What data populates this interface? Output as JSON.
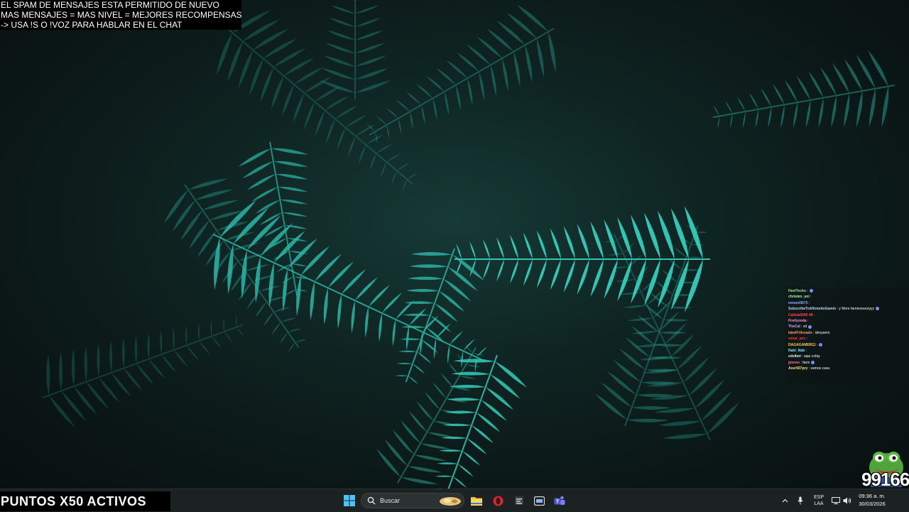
{
  "stream_overlay": {
    "lines": [
      "EL SPAM DE MENSAJES ESTA PERMITIDO DE NUEVO",
      "MAS MENSAJES = MAS NIVEL = MEJORES RECOMPENSAS",
      "-> USA !S  O !VOZ PARA HABLAR EN EL CHAT"
    ],
    "points_banner": "PUNTOS X50 ACTIVOS",
    "counter": "99166"
  },
  "chat": {
    "messages": [
      {
        "user": "HeelTecho",
        "text": ":",
        "color": "#9fe3a0"
      },
      {
        "user": "christen_uni",
        "text": ":",
        "color": "#b8f0b8"
      },
      {
        "user": "iwwani9875",
        "text": ":",
        "color": "#7fa7ff"
      },
      {
        "user": "SubscribeToAlfonsitoGamin",
        "text": ": y More farmeooooryyy",
        "color": "#c9d4ff"
      },
      {
        "user": "CalistaSHI5 48",
        "text": ":",
        "color": "#ff4a4a"
      },
      {
        "user": "Firefyonda",
        "text": ":",
        "color": "#ff8fd6"
      },
      {
        "user": "TheCal",
        "text": ": xd",
        "color": "#c9a4ff"
      },
      {
        "user": "labelFrliceado",
        "text": ": idroyeem",
        "color": "#ff9a6a"
      },
      {
        "user": "cesar_pro",
        "text": ":",
        "color": "#ff3b3b"
      },
      {
        "user": "DAGAGAMER11",
        "text": ":",
        "color": "#ffcf3a"
      },
      {
        "user": "Nabi_Nab",
        "text": ":",
        "color": "#8ee0ff"
      },
      {
        "user": "edelbot",
        "text": ": aqui cofay",
        "color": "#e8e8e8"
      },
      {
        "user": "jjmnne",
        "text": ": farm",
        "color": "#ff6a9c"
      },
      {
        "user": "Axer507pry",
        "text": ": vamos casa",
        "color": "#ffe07a"
      }
    ]
  },
  "taskbar": {
    "search_placeholder": "Buscar",
    "lang_top": "ESP",
    "lang_bottom": "LAA",
    "time": "09:36 a. m.",
    "date": "30/03/2026",
    "icons": [
      "windows-start-icon",
      "search-icon",
      "file-explorer-icon",
      "opera-icon",
      "app-icon",
      "app-icon-2",
      "teams-icon"
    ]
  },
  "colors": {
    "fern": "#2bb8a8",
    "fern_bright": "#36d6c3",
    "taskbar": "#1c2221"
  }
}
